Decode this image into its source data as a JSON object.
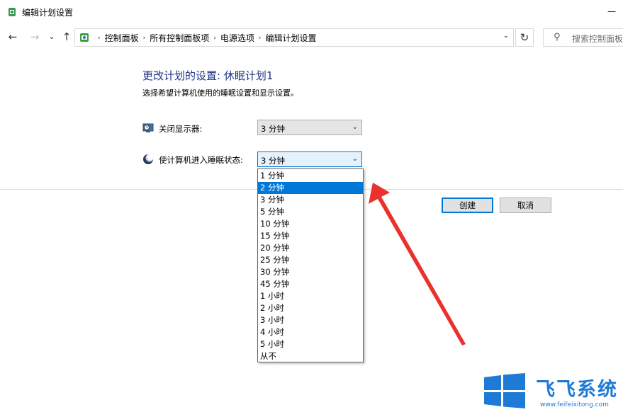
{
  "window": {
    "title": "编辑计划设置"
  },
  "nav": {
    "back": "←",
    "forward": "→",
    "recent": "⌄",
    "up": "↑",
    "refresh": "↻"
  },
  "address": {
    "breadcrumbs": [
      "控制面板",
      "所有控制面板项",
      "电源选项",
      "编辑计划设置"
    ],
    "separator": "›",
    "dropdown": "⌄"
  },
  "search": {
    "placeholder": "搜索控制面板",
    "icon": "⚲"
  },
  "main": {
    "heading": "更改计划的设置: 休眠计划1",
    "subtitle": "选择希望计算机使用的睡眠设置和显示设置。",
    "display_off": {
      "label": "关闭显示器:",
      "value": "3 分钟"
    },
    "sleep": {
      "label": "使计算机进入睡眠状态:",
      "value": "3 分钟"
    },
    "chevron": "⌄"
  },
  "buttons": {
    "create": "创建",
    "cancel": "取消"
  },
  "sleep_options": [
    "1 分钟",
    "2 分钟",
    "3 分钟",
    "5 分钟",
    "10 分钟",
    "15 分钟",
    "20 分钟",
    "25 分钟",
    "30 分钟",
    "45 分钟",
    "1 小时",
    "2 小时",
    "3 小时",
    "4 小时",
    "5 小时",
    "从不"
  ],
  "sleep_highlighted_index": 1,
  "watermark": {
    "text": "飞飞系统",
    "url": "www.feifeixitong.com"
  },
  "colors": {
    "accent": "#0078d7",
    "heading": "#1e3287",
    "arrow": "#e8322b",
    "watermark": "#1e7ad6"
  }
}
